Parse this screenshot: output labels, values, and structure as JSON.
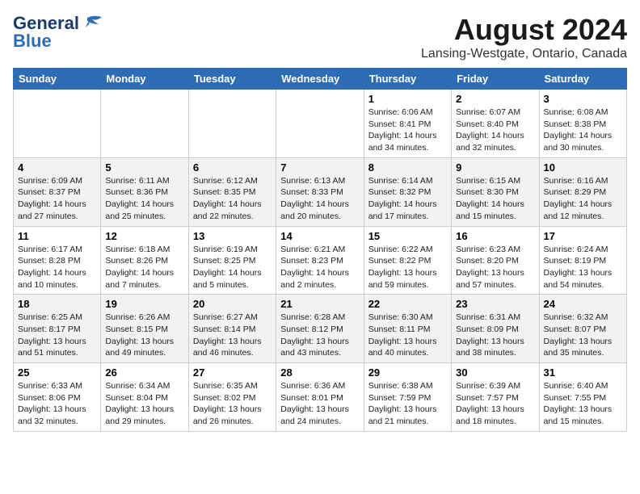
{
  "header": {
    "logo_line1": "General",
    "logo_line2": "Blue",
    "title": "August 2024",
    "subtitle": "Lansing-Westgate, Ontario, Canada"
  },
  "days_of_week": [
    "Sunday",
    "Monday",
    "Tuesday",
    "Wednesday",
    "Thursday",
    "Friday",
    "Saturday"
  ],
  "weeks": [
    [
      {
        "day": "",
        "info": ""
      },
      {
        "day": "",
        "info": ""
      },
      {
        "day": "",
        "info": ""
      },
      {
        "day": "",
        "info": ""
      },
      {
        "day": "1",
        "info": "Sunrise: 6:06 AM\nSunset: 8:41 PM\nDaylight: 14 hours and 34 minutes."
      },
      {
        "day": "2",
        "info": "Sunrise: 6:07 AM\nSunset: 8:40 PM\nDaylight: 14 hours and 32 minutes."
      },
      {
        "day": "3",
        "info": "Sunrise: 6:08 AM\nSunset: 8:38 PM\nDaylight: 14 hours and 30 minutes."
      }
    ],
    [
      {
        "day": "4",
        "info": "Sunrise: 6:09 AM\nSunset: 8:37 PM\nDaylight: 14 hours and 27 minutes."
      },
      {
        "day": "5",
        "info": "Sunrise: 6:11 AM\nSunset: 8:36 PM\nDaylight: 14 hours and 25 minutes."
      },
      {
        "day": "6",
        "info": "Sunrise: 6:12 AM\nSunset: 8:35 PM\nDaylight: 14 hours and 22 minutes."
      },
      {
        "day": "7",
        "info": "Sunrise: 6:13 AM\nSunset: 8:33 PM\nDaylight: 14 hours and 20 minutes."
      },
      {
        "day": "8",
        "info": "Sunrise: 6:14 AM\nSunset: 8:32 PM\nDaylight: 14 hours and 17 minutes."
      },
      {
        "day": "9",
        "info": "Sunrise: 6:15 AM\nSunset: 8:30 PM\nDaylight: 14 hours and 15 minutes."
      },
      {
        "day": "10",
        "info": "Sunrise: 6:16 AM\nSunset: 8:29 PM\nDaylight: 14 hours and 12 minutes."
      }
    ],
    [
      {
        "day": "11",
        "info": "Sunrise: 6:17 AM\nSunset: 8:28 PM\nDaylight: 14 hours and 10 minutes."
      },
      {
        "day": "12",
        "info": "Sunrise: 6:18 AM\nSunset: 8:26 PM\nDaylight: 14 hours and 7 minutes."
      },
      {
        "day": "13",
        "info": "Sunrise: 6:19 AM\nSunset: 8:25 PM\nDaylight: 14 hours and 5 minutes."
      },
      {
        "day": "14",
        "info": "Sunrise: 6:21 AM\nSunset: 8:23 PM\nDaylight: 14 hours and 2 minutes."
      },
      {
        "day": "15",
        "info": "Sunrise: 6:22 AM\nSunset: 8:22 PM\nDaylight: 13 hours and 59 minutes."
      },
      {
        "day": "16",
        "info": "Sunrise: 6:23 AM\nSunset: 8:20 PM\nDaylight: 13 hours and 57 minutes."
      },
      {
        "day": "17",
        "info": "Sunrise: 6:24 AM\nSunset: 8:19 PM\nDaylight: 13 hours and 54 minutes."
      }
    ],
    [
      {
        "day": "18",
        "info": "Sunrise: 6:25 AM\nSunset: 8:17 PM\nDaylight: 13 hours and 51 minutes."
      },
      {
        "day": "19",
        "info": "Sunrise: 6:26 AM\nSunset: 8:15 PM\nDaylight: 13 hours and 49 minutes."
      },
      {
        "day": "20",
        "info": "Sunrise: 6:27 AM\nSunset: 8:14 PM\nDaylight: 13 hours and 46 minutes."
      },
      {
        "day": "21",
        "info": "Sunrise: 6:28 AM\nSunset: 8:12 PM\nDaylight: 13 hours and 43 minutes."
      },
      {
        "day": "22",
        "info": "Sunrise: 6:30 AM\nSunset: 8:11 PM\nDaylight: 13 hours and 40 minutes."
      },
      {
        "day": "23",
        "info": "Sunrise: 6:31 AM\nSunset: 8:09 PM\nDaylight: 13 hours and 38 minutes."
      },
      {
        "day": "24",
        "info": "Sunrise: 6:32 AM\nSunset: 8:07 PM\nDaylight: 13 hours and 35 minutes."
      }
    ],
    [
      {
        "day": "25",
        "info": "Sunrise: 6:33 AM\nSunset: 8:06 PM\nDaylight: 13 hours and 32 minutes."
      },
      {
        "day": "26",
        "info": "Sunrise: 6:34 AM\nSunset: 8:04 PM\nDaylight: 13 hours and 29 minutes."
      },
      {
        "day": "27",
        "info": "Sunrise: 6:35 AM\nSunset: 8:02 PM\nDaylight: 13 hours and 26 minutes."
      },
      {
        "day": "28",
        "info": "Sunrise: 6:36 AM\nSunset: 8:01 PM\nDaylight: 13 hours and 24 minutes."
      },
      {
        "day": "29",
        "info": "Sunrise: 6:38 AM\nSunset: 7:59 PM\nDaylight: 13 hours and 21 minutes."
      },
      {
        "day": "30",
        "info": "Sunrise: 6:39 AM\nSunset: 7:57 PM\nDaylight: 13 hours and 18 minutes."
      },
      {
        "day": "31",
        "info": "Sunrise: 6:40 AM\nSunset: 7:55 PM\nDaylight: 13 hours and 15 minutes."
      }
    ]
  ]
}
